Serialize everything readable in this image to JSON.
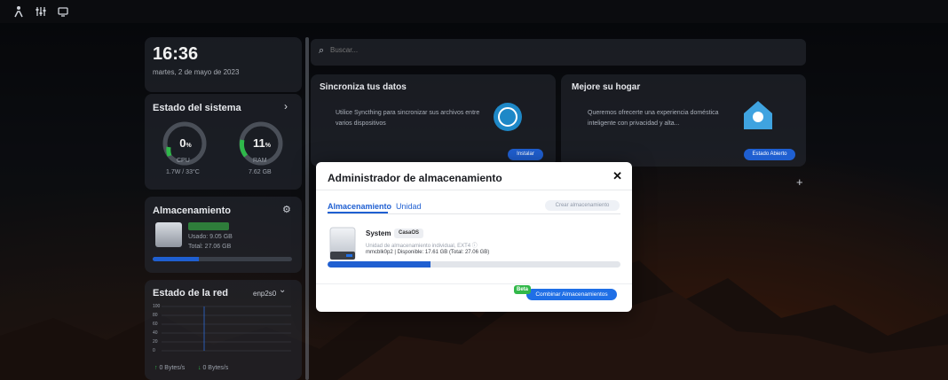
{
  "topbar": {
    "icons": [
      "person-icon",
      "sliders-icon",
      "screen-icon"
    ]
  },
  "widgets": {
    "clock": {
      "time": "16:36",
      "date": "martes, 2 de mayo de 2023"
    },
    "system": {
      "title": "Estado del sistema",
      "cpu": {
        "value": "0",
        "unit": "%",
        "label": "CPU",
        "power": "1.7W / 33°C"
      },
      "ram": {
        "value": "11",
        "unit": "%",
        "label": "RAM",
        "size": "7.62 GB"
      }
    },
    "storage": {
      "title": "Almacenamiento",
      "used": "Usado: 9.05 GB",
      "total": "Total: 27.06 GB",
      "used_fraction": 0.33
    },
    "network": {
      "title": "Estado de la red",
      "interface": "enp2s0",
      "upload": "0 Bytes/s",
      "download": "0 Bytes/s",
      "y_ticks": [
        "100",
        "80",
        "60",
        "40",
        "20",
        "0"
      ]
    }
  },
  "search": {
    "placeholder": "Buscar..."
  },
  "apps": [
    {
      "title": "Sincroniza tus datos",
      "desc": "Utilice Syncthing para sincronizar sus archivos entre varios dispositivos",
      "button": "Instalar"
    },
    {
      "title": "Mejore su hogar",
      "desc": "Queremos ofrecerte una experiencia doméstica inteligente con privacidad y alta...",
      "button": "Estado Abierto"
    }
  ],
  "modal": {
    "title": "Administrador de almacenamiento",
    "close": "✕",
    "tabs": [
      "Almacenamiento",
      "Unidad"
    ],
    "create_button": "Crear almacenamiento",
    "storage_item": {
      "name": "System",
      "badge": "CasaOS",
      "type": "Unidad de almacenamiento individual, EXT4 ⓘ",
      "detail": "mmcblk0p2 | Disponible: 17.61 GB (Total: 27.06 GB)",
      "used_fraction": 0.35
    },
    "beta_badge": "Beta",
    "combine_button": "Combinar Almacenamientos"
  },
  "colors": {
    "accent": "#1f5fd1",
    "beta": "#32b84a",
    "gauge_cpu": "#2fb84a",
    "gauge_ram": "#2fb84a"
  }
}
